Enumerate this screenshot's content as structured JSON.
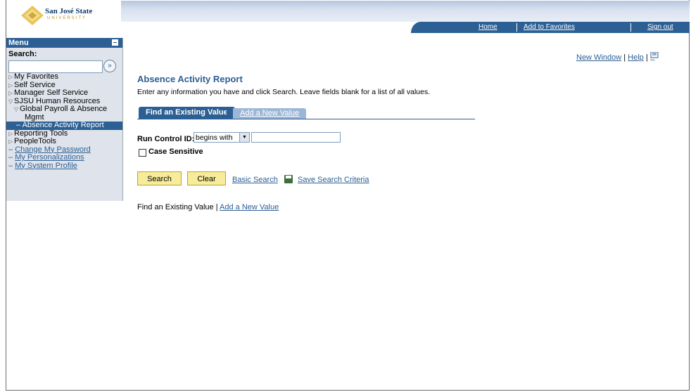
{
  "logo": {
    "name": "San José State",
    "sub": "UNIVERSITY"
  },
  "nav": {
    "home": "Home",
    "favorites": "Add to Favorites",
    "signout": "Sign out"
  },
  "menu": {
    "title": "Menu",
    "search_label": "Search:",
    "search_value": "",
    "items": [
      {
        "label": "My Favorites"
      },
      {
        "label": "Self Service"
      },
      {
        "label": "Manager Self Service"
      },
      {
        "label": "SJSU Human Resources"
      },
      {
        "label": "Global Payroll & Absence"
      },
      {
        "label": "Mgmt"
      },
      {
        "label": "– Absence Activity Report"
      },
      {
        "label": "Reporting Tools"
      },
      {
        "label": "PeopleTools"
      },
      {
        "label": "Change My Password"
      },
      {
        "label": "My Personalizations"
      },
      {
        "label": "My System Profile"
      }
    ]
  },
  "page_links": {
    "new_window": "New Window",
    "help": "Help"
  },
  "page": {
    "title": "Absence Activity Report",
    "instructions": "Enter any information you have and click Search. Leave fields blank for a list of all values.",
    "tab_find": "Find an Existing Value",
    "tab_add": "Add a New Value",
    "run_control_label": "Run Control ID:",
    "operator": "begins with",
    "run_control_value": "",
    "case_sensitive": "Case Sensitive",
    "search_btn": "Search",
    "clear_btn": "Clear",
    "basic_search": "Basic Search",
    "save_criteria": "Save Search Criteria",
    "bottom_find": "Find an Existing Value",
    "bottom_add": "Add a New Value"
  },
  "colors": {
    "accent": "#2c5f93",
    "button": "#f6ec9a"
  }
}
